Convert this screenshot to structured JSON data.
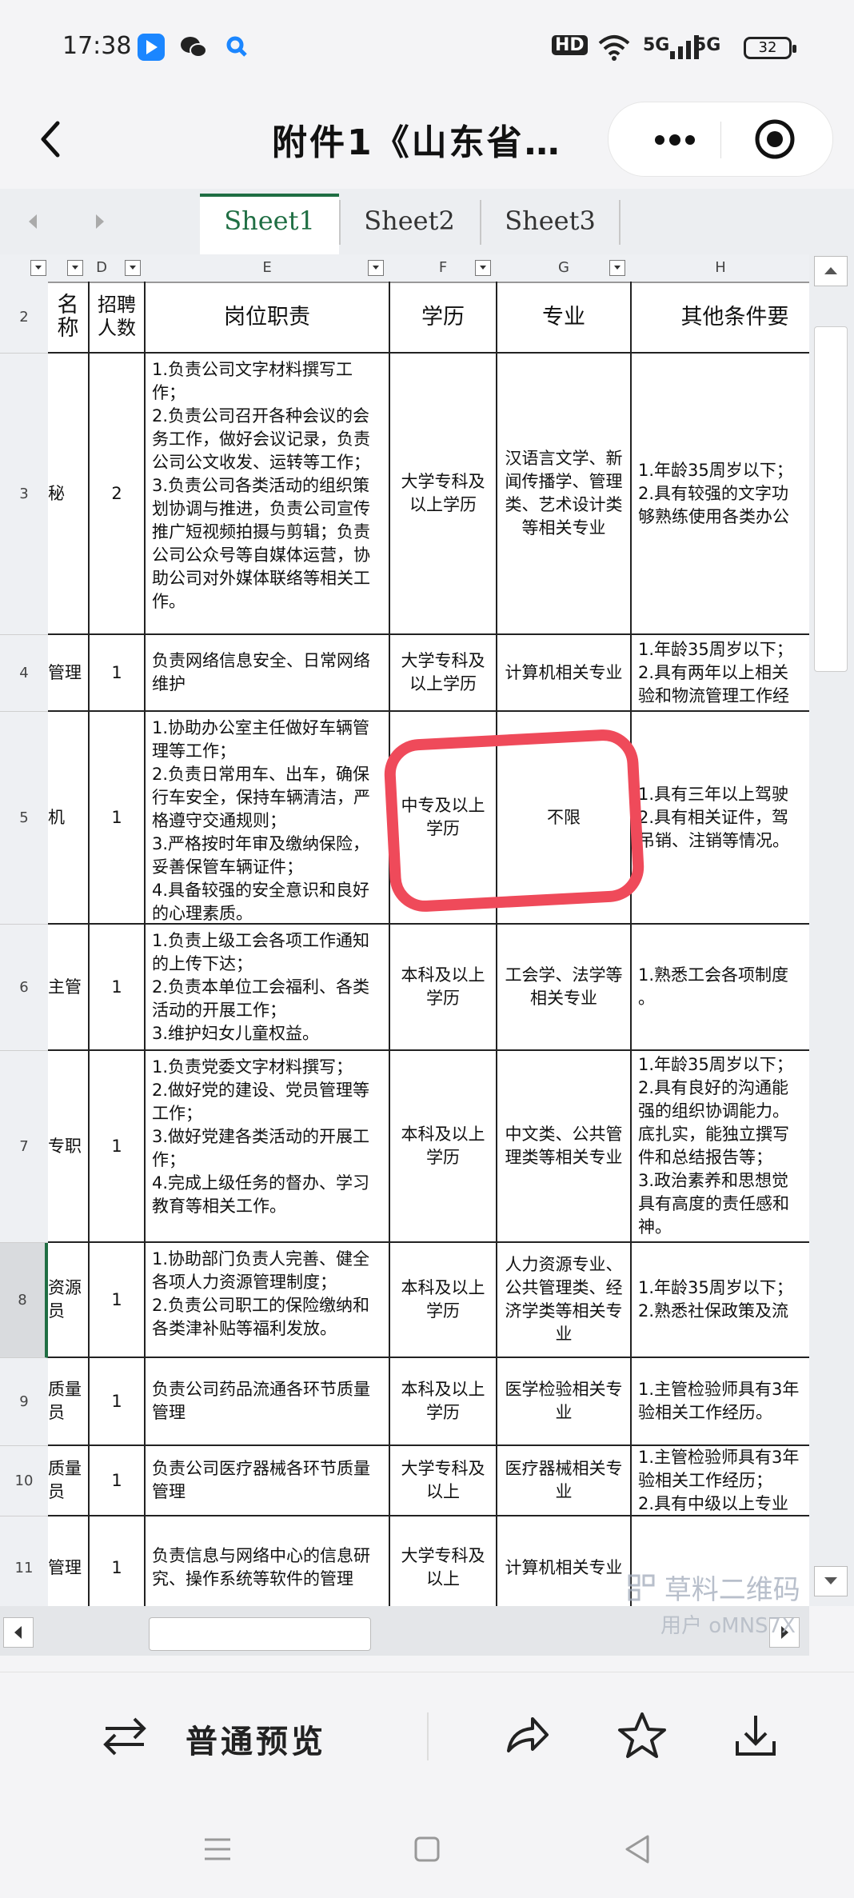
{
  "status_bar": {
    "time": "17:38",
    "app_icons": [
      "pay-app-icon",
      "wechat-icon",
      "search-app-icon"
    ],
    "hd_badge": "HD",
    "network_1": "5G",
    "network_2": "5G",
    "battery": "32"
  },
  "header": {
    "title": "附件1《山东省…"
  },
  "sheet_tabs": [
    {
      "label": "Sheet1",
      "active": true
    },
    {
      "label": "Sheet2",
      "active": false
    },
    {
      "label": "Sheet3",
      "active": false
    }
  ],
  "columns": [
    "D",
    "E",
    "F",
    "G",
    "H"
  ],
  "table": {
    "header_row": {
      "row_num": "2",
      "c": "名称",
      "d": "招聘人数",
      "e": "岗位职责",
      "f": "学历",
      "g": "专业",
      "h": "其他条件要"
    },
    "rows": [
      {
        "row_num": "3",
        "c": "秘",
        "d": "2",
        "e": "1.负责公司文字材料撰写工作；\n2.负责公司召开各种会议的会务工作，做好会议记录，负责公司公文收发、运转等工作；\n3.负责公司各类活动的组织策划协调与推进，负责公司宣传推广短视频拍摄与剪辑；负责公司公众号等自媒体运营，协助公司对外媒体联络等相关工作。",
        "f": "大学专科及以上学历",
        "g": "汉语言文学、新闻传播学、管理类、艺术设计类等相关专业",
        "h": "1.年龄35周岁以下；\n2.具有较强的文字功\n够熟练使用各类办公"
      },
      {
        "row_num": "4",
        "c": "管理",
        "d": "1",
        "e": "负责网络信息安全、日常网络维护",
        "f": "大学专科及以上学历",
        "g": "计算机相关专业",
        "h": "1.年龄35周岁以下；\n2.具有两年以上相关\n验和物流管理工作经"
      },
      {
        "row_num": "5",
        "c": "机",
        "d": "1",
        "e": "1.协助办公室主任做好车辆管理等工作；\n2.负责日常用车、出车，确保行车安全，保持车辆清洁，严格遵守交通规则；\n3.严格按时年审及缴纳保险，妥善保管车辆证件；\n4.具备较强的安全意识和良好的心理素质。",
        "f": "中专及以上学历",
        "g": "不限",
        "h": "1.具有三年以上驾驶\n2.具有相关证件，驾\n吊销、注销等情况。"
      },
      {
        "row_num": "6",
        "c": "主管",
        "d": "1",
        "e": "1.负责上级工会各项工作通知的上传下达；\n2.负责本单位工会福利、各类活动的开展工作；\n3.维护妇女儿童权益。",
        "f": "本科及以上学历",
        "g": "工会学、法学等相关专业",
        "h": "1.熟悉工会各项制度\n。"
      },
      {
        "row_num": "7",
        "c": "专职",
        "d": "1",
        "e": "1.负责党委文字材料撰写；\n2.做好党的建设、党员管理等工作；\n3.做好党建各类活动的开展工作；\n4.完成上级任务的督办、学习教育等相关工作。",
        "f": "本科及以上学历",
        "g": "中文类、公共管理类等相关专业",
        "h": "1.年龄35周岁以下；\n2.具有良好的沟通能\n强的组织协调能力。\n底扎实，能独立撰写\n件和总结报告等；\n3.政治素养和思想觉\n具有高度的责任感和\n神。"
      },
      {
        "row_num": "8",
        "c": "资源\n员",
        "d": "1",
        "e": "1.协助部门负责人完善、健全各项人力资源管理制度；\n2.负责公司职工的保险缴纳和各类津补贴等福利发放。",
        "f": "本科及以上学历",
        "g": "人力资源专业、公共管理类、经济学类等相关专业",
        "h": "1.年龄35周岁以下；\n2.熟悉社保政策及流"
      },
      {
        "row_num": "9",
        "c": "质量\n员",
        "d": "1",
        "e": "负责公司药品流通各环节质量管理",
        "f": "本科及以上学历",
        "g": "医学检验相关专业",
        "h": "1.主管检验师具有3年\n验相关工作经历。"
      },
      {
        "row_num": "10",
        "c": "质量\n员",
        "d": "1",
        "e": "负责公司医疗器械各环节质量管理",
        "f": "大学专科及以上",
        "g": "医疗器械相关专业",
        "h": "1.主管检验师具有3年\n验相关工作经历；\n2.具有中级以上专业"
      },
      {
        "row_num": "11",
        "c": "管理",
        "d": "1",
        "e": "负责信息与网络中心的信息研究、操作系统等软件的管理",
        "f": "大学专科及以上",
        "g": "计算机相关专业",
        "h": ""
      }
    ]
  },
  "watermark": {
    "text": "草料二维码",
    "user": "用户 oMNS7X"
  },
  "toolbar": {
    "preview_label": "普通预览"
  },
  "colors": {
    "accent_green": "#1f6e43",
    "annotation_red": "#ef4a5a"
  }
}
